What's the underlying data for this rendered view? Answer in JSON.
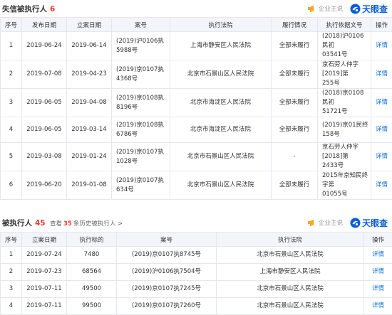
{
  "section1": {
    "title": "失信被执行人",
    "count": "6",
    "enterprise_label": "企业主说",
    "logo_text": "天眼查",
    "headers": [
      "序号",
      "发布日期",
      "立案日期",
      "案号",
      "执行法院",
      "履行情况",
      "执行依据文号",
      "操作"
    ],
    "rows": [
      {
        "no": "1",
        "pub": "2019-06-24",
        "filed": "2019-06-14",
        "case": "(2019)沪0106执\n5988号",
        "court": "上海市静安区人民法院",
        "status": "全部未履行",
        "basis": "(2018)沪0106民初\n03541号",
        "action": "详情"
      },
      {
        "no": "2",
        "pub": "2019-07-08",
        "filed": "2019-04-23",
        "case": "(2019)京0107执\n4368号",
        "court": "北京市石景山区人民法院",
        "status": "全部未履行",
        "basis": "京石劳人仲字[2019]第\n255号",
        "action": "详情"
      },
      {
        "no": "3",
        "pub": "2019-06-05",
        "filed": "2019-04-08",
        "case": "(2019)京0108执\n8196号",
        "court": "北京市海淀区人民法院",
        "status": "全部未履行",
        "basis": "(2018)京0108民初\n51721号",
        "action": "详情"
      },
      {
        "no": "4",
        "pub": "2019-06-05",
        "filed": "2019-03-14",
        "case": "(2019)京0108执\n6786号",
        "court": "北京市海淀区人民法院",
        "status": "全部未履行",
        "basis": "(2019)京01民终158号",
        "action": "详情"
      },
      {
        "no": "5",
        "pub": "2019-03-08",
        "filed": "2019-01-24",
        "case": "(2019)京0107执\n1028号",
        "court": "北京市石景山区人民法院",
        "status": "-",
        "basis": "京石劳人仲字[2018]第\n2433号",
        "action": "详情"
      },
      {
        "no": "6",
        "pub": "2019-06-20",
        "filed": "2019-01-08",
        "case": "(2019)京0107执\n634号",
        "court": "北京市石景山区人民法院",
        "status": "全部未履行",
        "basis": "2015年京知民终字第\n01055号",
        "action": "详情"
      }
    ]
  },
  "section2": {
    "title": "被执行人",
    "count": "45",
    "history_prefix": "查看",
    "history_count": "35",
    "history_suffix": "条历史被执行人 >",
    "enterprise_label": "企业主说",
    "logo_text": "天眼查",
    "headers": [
      "序号",
      "立案日期",
      "执行标的",
      "案号",
      "执行法院",
      "操作"
    ],
    "rows": [
      {
        "no": "1",
        "filed": "2019-07-24",
        "amount": "7480",
        "case": "(2019)京0107执8745号",
        "court": "北京市石景山区人民法院",
        "action": "详情"
      },
      {
        "no": "2",
        "filed": "2019-07-23",
        "amount": "68564",
        "case": "(2019)沪0106执7504号",
        "court": "上海市静安区人民法院",
        "action": "详情"
      },
      {
        "no": "3",
        "filed": "2019-07-11",
        "amount": "49500",
        "case": "(2019)京0107执7245号",
        "court": "北京市石景山区人民法院",
        "action": "详情"
      },
      {
        "no": "4",
        "filed": "2019-07-11",
        "amount": "99500",
        "case": "(2019)京0107执7260号",
        "court": "北京市石景山区人民法院",
        "action": "详情"
      }
    ]
  },
  "colors": {
    "accent_red": "#e63c2e",
    "link_blue": "#0b6fd6",
    "logo_blue": "#0b5ed7",
    "header_bg": "#f2f6fb",
    "border": "#e4e8ee",
    "enterprise_orange": "#f5a623"
  }
}
